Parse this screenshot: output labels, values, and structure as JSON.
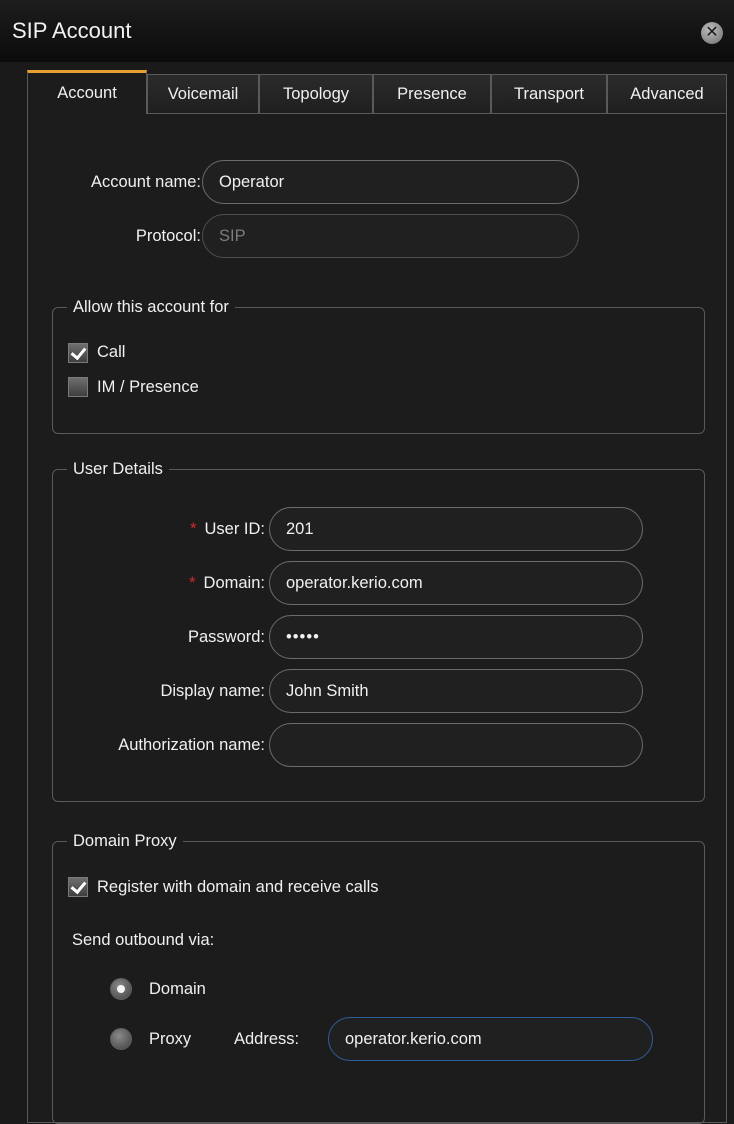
{
  "window": {
    "title": "SIP Account",
    "close_icon": "close-icon"
  },
  "tabs": [
    {
      "label": "Account",
      "active": true
    },
    {
      "label": "Voicemail",
      "active": false
    },
    {
      "label": "Topology",
      "active": false
    },
    {
      "label": "Presence",
      "active": false
    },
    {
      "label": "Transport",
      "active": false
    },
    {
      "label": "Advanced",
      "active": false
    }
  ],
  "account": {
    "account_name_label": "Account name:",
    "account_name_value": "Operator",
    "protocol_label": "Protocol:",
    "protocol_value": "SIP"
  },
  "allow_group": {
    "legend": "Allow this account for",
    "call_label": "Call",
    "call_checked": true,
    "im_label": "IM / Presence",
    "im_checked": false
  },
  "user_details": {
    "legend": "User Details",
    "required_mark": "*",
    "user_id_label": "User ID:",
    "user_id_value": "201",
    "domain_label": "Domain:",
    "domain_value": "operator.kerio.com",
    "password_label": "Password:",
    "password_value": "•••••",
    "display_name_label": "Display name:",
    "display_name_value": "John Smith",
    "auth_name_label": "Authorization name:",
    "auth_name_value": ""
  },
  "domain_proxy": {
    "legend": "Domain Proxy",
    "register_label": "Register with domain and receive calls",
    "register_checked": true,
    "send_outbound_label": "Send outbound via:",
    "domain_option": "Domain",
    "proxy_option": "Proxy",
    "selected": "Domain",
    "address_label": "Address:",
    "address_value": "operator.kerio.com"
  },
  "colors": {
    "active_tab_accent": "#e8a030",
    "required": "#d02a2a",
    "focus_border": "#2f5f9a"
  }
}
